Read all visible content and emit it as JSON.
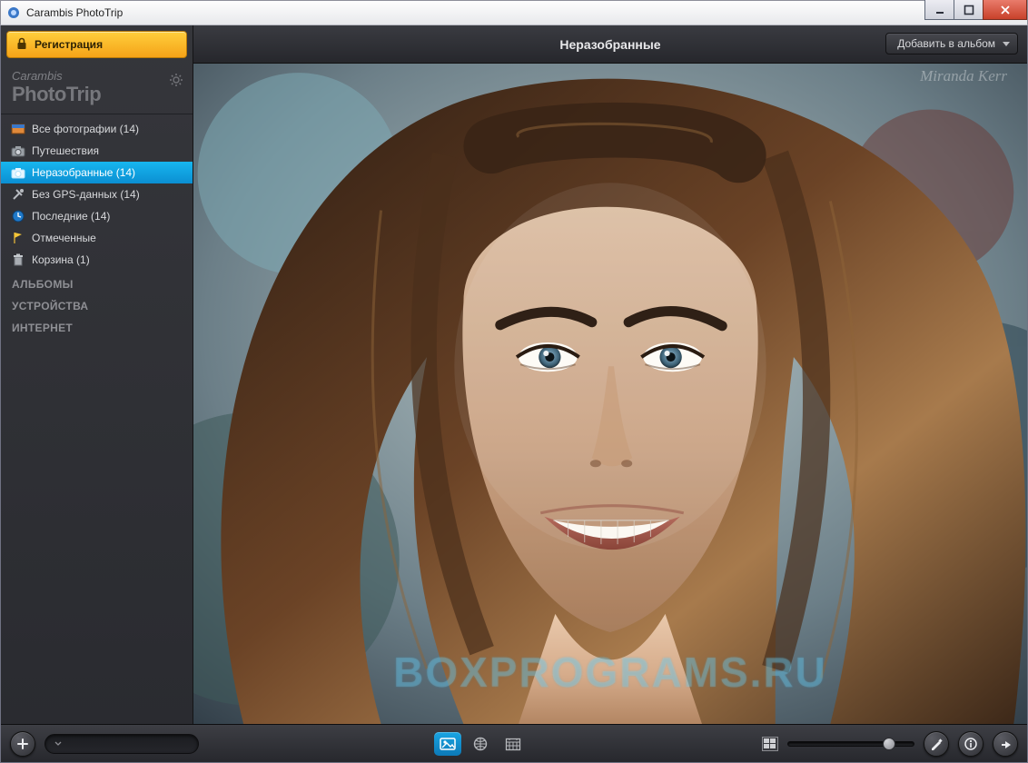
{
  "window": {
    "title": "Carambis PhotoTrip"
  },
  "registration": {
    "label": "Регистрация"
  },
  "brand": {
    "line1": "Carambis",
    "line2": "PhotoTrip"
  },
  "sidebar": {
    "items": [
      {
        "icon": "photos-icon",
        "label": "Все фотографии (14)"
      },
      {
        "icon": "camera-icon",
        "label": "Путешествия"
      },
      {
        "icon": "camera-icon",
        "label": "Неразобранные (14)"
      },
      {
        "icon": "tools-icon",
        "label": "Без GPS-данных (14)"
      },
      {
        "icon": "clock-icon",
        "label": "Последние (14)"
      },
      {
        "icon": "flag-icon",
        "label": "Отмеченные"
      },
      {
        "icon": "trash-icon",
        "label": "Корзина (1)"
      }
    ],
    "sections": {
      "albums": "АЛЬБОМЫ",
      "devices": "УСТРОЙСТВА",
      "internet": "ИНТЕРНЕТ"
    }
  },
  "header": {
    "title": "Неразобранные",
    "add_to_album": "Добавить в альбом"
  },
  "footer": {
    "search_placeholder": ""
  },
  "watermark": "BOXPROGRAMS.RU",
  "signature": "Miranda Kerr",
  "colors": {
    "accent": "#0f9cd9",
    "highlight": "#f7b51b"
  }
}
